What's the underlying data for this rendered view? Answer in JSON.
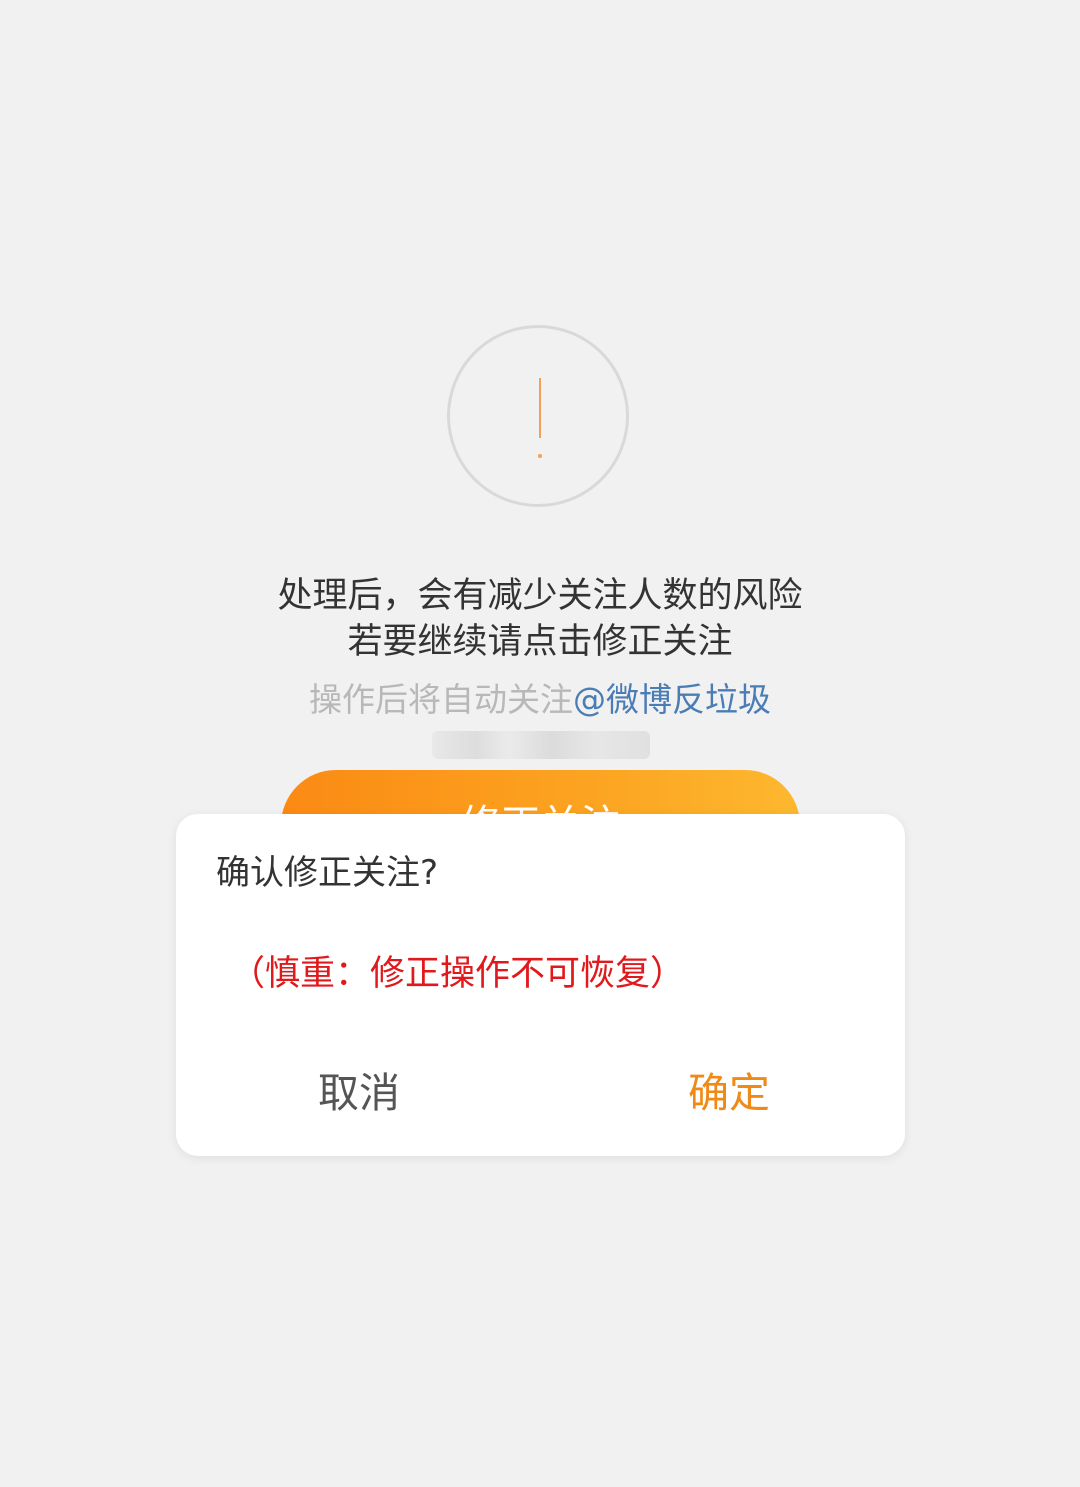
{
  "main": {
    "line1": "处理后，会有减少关注人数的风险",
    "line2": "若要继续请点击修正关注",
    "follow_prefix": "操作后将自动关注",
    "follow_mention": "@微博反垃圾",
    "fix_button_label": "修正关注"
  },
  "dialog": {
    "title": "确认修正关注?",
    "warning": "（慎重：修正操作不可恢复）",
    "cancel_label": "取消",
    "confirm_label": "确定"
  },
  "colors": {
    "accent_orange": "#f08a17",
    "button_gradient_start": "#fb8a14",
    "button_gradient_end": "#fdb82f",
    "warning_red": "#e0191c",
    "mention_blue": "#4a7db6",
    "background": "#f1f1f1"
  },
  "icons": {
    "status_icon": "exclamation-circle-icon"
  }
}
